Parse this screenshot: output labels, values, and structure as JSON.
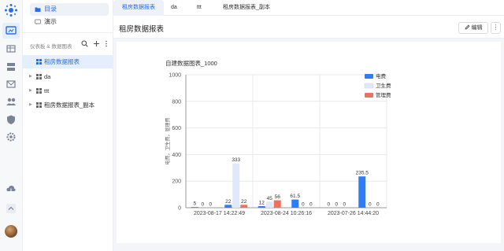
{
  "sidebar": {
    "nav": [
      {
        "label": "目录",
        "active": true
      },
      {
        "label": "演示",
        "active": false
      }
    ],
    "section_title": "仪表板 & 数据图表",
    "tree": [
      {
        "label": "租房数据报表",
        "active": true,
        "expandable": false
      },
      {
        "label": "da",
        "active": false,
        "expandable": true
      },
      {
        "label": "ttt",
        "active": false,
        "expandable": true
      },
      {
        "label": "租房数据报表_副本",
        "active": false,
        "expandable": true
      }
    ]
  },
  "tabs": [
    {
      "label": "租房数据报表",
      "active": true
    },
    {
      "label": "da",
      "active": false
    },
    {
      "label": "ttt",
      "active": false
    },
    {
      "label": "租房数据报表_副本",
      "active": false
    }
  ],
  "page": {
    "title": "租房数据报表",
    "edit_label": "编辑",
    "more_label": "⋮"
  },
  "chart_data": {
    "type": "bar",
    "title": "自建数据图表_1000",
    "ylabel": "电费，卫生费，管理费",
    "ylim": [
      0,
      1000
    ],
    "yticks": [
      0,
      200,
      400,
      600,
      800,
      1000
    ],
    "categories": [
      "2023-08-17 14:22:49",
      "2023-08-24 10:26:16",
      "2023-07-26 14:44:20"
    ],
    "subgroups": 4,
    "series": [
      {
        "name": "电费",
        "color": "#2f7df6",
        "values": [
          5,
          22,
          12,
          61.5,
          0,
          235.5
        ]
      },
      {
        "name": "卫生费",
        "color": "#dfe9fb",
        "values": [
          0,
          333,
          45,
          0,
          0,
          0
        ]
      },
      {
        "name": "管理费",
        "color": "#f07060",
        "values": [
          0,
          22,
          56,
          0,
          0,
          0
        ]
      }
    ],
    "legend_position": "top-right",
    "grid": true
  }
}
